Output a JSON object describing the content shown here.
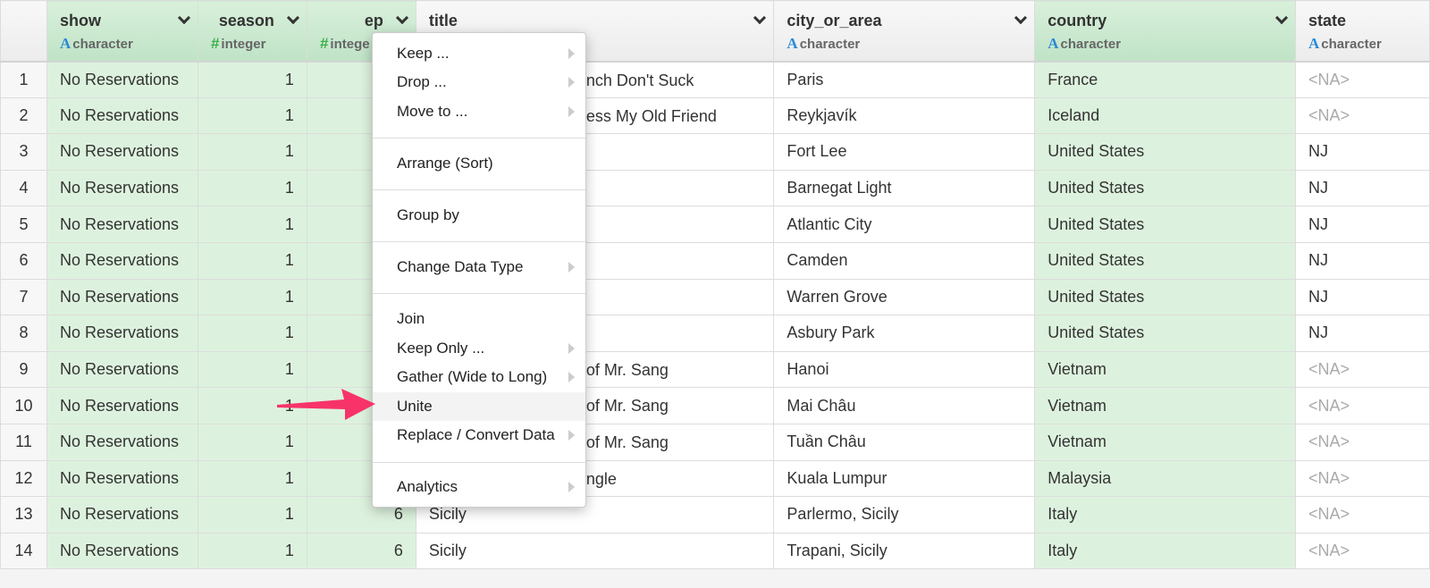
{
  "columns": [
    {
      "name": "show",
      "type": "character",
      "type_icon": "A",
      "green": true
    },
    {
      "name": "season",
      "type": "integer",
      "type_icon": "#",
      "green": true
    },
    {
      "name": "ep",
      "type": "integer",
      "type_icon": "#",
      "green": true
    },
    {
      "name": "title",
      "type": "",
      "type_icon": "",
      "green": false
    },
    {
      "name": "city_or_area",
      "type": "character",
      "type_icon": "A",
      "green": false
    },
    {
      "name": "country",
      "type": "character",
      "type_icon": "A",
      "green": true
    },
    {
      "name": "state",
      "type": "character",
      "type_icon": "A",
      "green": false
    }
  ],
  "ep_type_visible": "intege",
  "rows": [
    {
      "n": "1",
      "show": "No Reservations",
      "season": "1",
      "ep": "",
      "title": "nch Don't Suck",
      "city": "Paris",
      "country": "France",
      "state": "<NA>"
    },
    {
      "n": "2",
      "show": "No Reservations",
      "season": "1",
      "ep": "",
      "title": "ess My Old Friend",
      "city": "Reykjavík",
      "country": "Iceland",
      "state": "<NA>"
    },
    {
      "n": "3",
      "show": "No Reservations",
      "season": "1",
      "ep": "",
      "title": "",
      "city": "Fort Lee",
      "country": "United States",
      "state": "NJ"
    },
    {
      "n": "4",
      "show": "No Reservations",
      "season": "1",
      "ep": "",
      "title": "",
      "city": "Barnegat Light",
      "country": "United States",
      "state": "NJ"
    },
    {
      "n": "5",
      "show": "No Reservations",
      "season": "1",
      "ep": "",
      "title": "",
      "city": "Atlantic City",
      "country": "United States",
      "state": "NJ"
    },
    {
      "n": "6",
      "show": "No Reservations",
      "season": "1",
      "ep": "",
      "title": "",
      "city": "Camden",
      "country": "United States",
      "state": "NJ"
    },
    {
      "n": "7",
      "show": "No Reservations",
      "season": "1",
      "ep": "",
      "title": "",
      "city": "Warren Grove",
      "country": "United States",
      "state": "NJ"
    },
    {
      "n": "8",
      "show": "No Reservations",
      "season": "1",
      "ep": "",
      "title": "",
      "city": "Asbury Park",
      "country": "United States",
      "state": "NJ"
    },
    {
      "n": "9",
      "show": "No Reservations",
      "season": "1",
      "ep": "",
      "title": "of Mr. Sang",
      "city": "Hanoi",
      "country": "Vietnam",
      "state": "<NA>"
    },
    {
      "n": "10",
      "show": "No Reservations",
      "season": "1",
      "ep": "",
      "title": "of Mr. Sang",
      "city": "Mai Châu",
      "country": "Vietnam",
      "state": "<NA>"
    },
    {
      "n": "11",
      "show": "No Reservations",
      "season": "1",
      "ep": "",
      "title": "of Mr. Sang",
      "city": "Tuần Châu",
      "country": "Vietnam",
      "state": "<NA>"
    },
    {
      "n": "12",
      "show": "No Reservations",
      "season": "1",
      "ep": "",
      "title": "ngle",
      "city": "Kuala Lumpur",
      "country": "Malaysia",
      "state": "<NA>"
    },
    {
      "n": "13",
      "show": "No Reservations",
      "season": "1",
      "ep": "6",
      "title": "Sicily",
      "city": "Parlermo, Sicily",
      "country": "Italy",
      "state": "<NA>"
    },
    {
      "n": "14",
      "show": "No Reservations",
      "season": "1",
      "ep": "6",
      "title": "Sicily",
      "city": "Trapani, Sicily",
      "country": "Italy",
      "state": "<NA>"
    }
  ],
  "menu": [
    {
      "label": "Keep ...",
      "submenu": true
    },
    {
      "label": "Drop ...",
      "submenu": true
    },
    {
      "label": "Move to ...",
      "submenu": true
    },
    {
      "label": "Arrange (Sort)",
      "submenu": false
    },
    {
      "label": "Group by",
      "submenu": false
    },
    {
      "label": "Change Data Type",
      "submenu": true
    },
    {
      "label": "Join",
      "submenu": false
    },
    {
      "label": "Keep Only ...",
      "submenu": true
    },
    {
      "label": "Gather (Wide to Long)",
      "submenu": true
    },
    {
      "label": "Unite",
      "submenu": false,
      "highlighted": true
    },
    {
      "label": "Replace / Convert Data",
      "submenu": true
    },
    {
      "label": "Analytics",
      "submenu": true
    }
  ],
  "colors": {
    "green_cell": "#ddf2de",
    "arrow": "#f7336a",
    "type_char": "#2a8ad8",
    "type_int": "#3cb04a"
  }
}
